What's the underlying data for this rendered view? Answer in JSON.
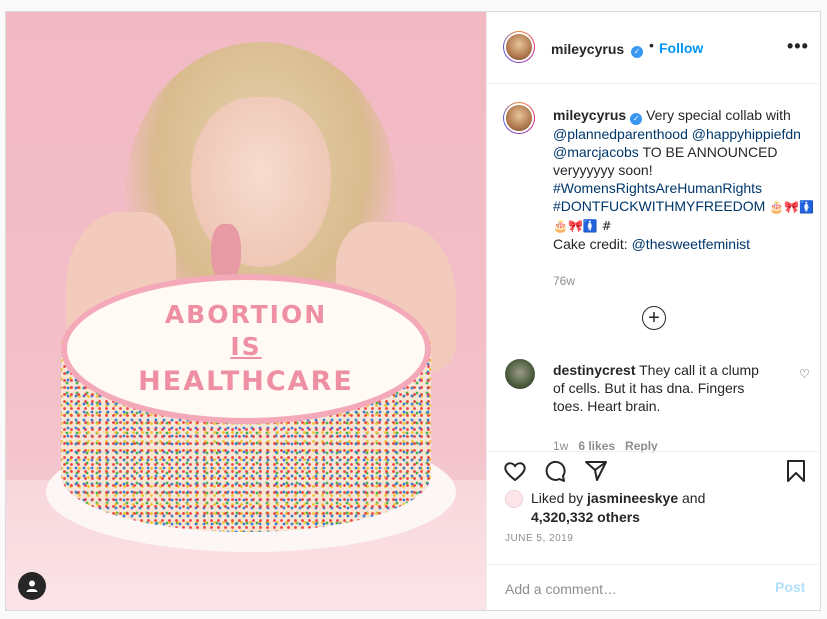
{
  "post": {
    "author": "mileycyrus",
    "verified_mark": "✓",
    "dot": "•",
    "follow_label": "Follow",
    "more_label": "•••"
  },
  "image": {
    "cake_line1": "ABORTION",
    "cake_line2": "IS",
    "cake_line3": "HEALTHCARE"
  },
  "caption": {
    "username": "mileycyrus",
    "text_1": "Very special collab with",
    "mention_1": "@plannedparenthood",
    "mention_2": "@happyhippiefdn",
    "mention_3": "@marcjacobs",
    "text_2": "TO BE ANNOUNCED veryyyyyy soon!",
    "hashtag_1": "#WomensRightsAreHumanRights",
    "hashtag_2": "#DONTFUCKWITHMYFREEDOM",
    "emoji_1": "🎂🎀🚺",
    "emoji_2": "🎂🎀🚺 #",
    "credit_label": "Cake credit:",
    "credit_mention": "@thesweetfeminist",
    "time": "76w"
  },
  "load_more_label": "+",
  "comment": {
    "username": "destinycrest",
    "text": "They call it a clump of cells. But it has dna. Fingers toes. Heart brain.",
    "time": "1w",
    "likes": "6 likes",
    "reply": "Reply",
    "heart": "♡"
  },
  "likes": {
    "prefix": "Liked by",
    "user": "jasmineeskye",
    "and": "and",
    "others": "4,320,332 others",
    "date": "JUNE 5, 2019"
  },
  "add_comment": {
    "placeholder": "Add a comment…",
    "post_label": "Post"
  },
  "colors": {
    "link": "#00376b",
    "follow": "#0095f6",
    "muted": "#8e8e8e",
    "post_disabled": "#b2dffc"
  }
}
